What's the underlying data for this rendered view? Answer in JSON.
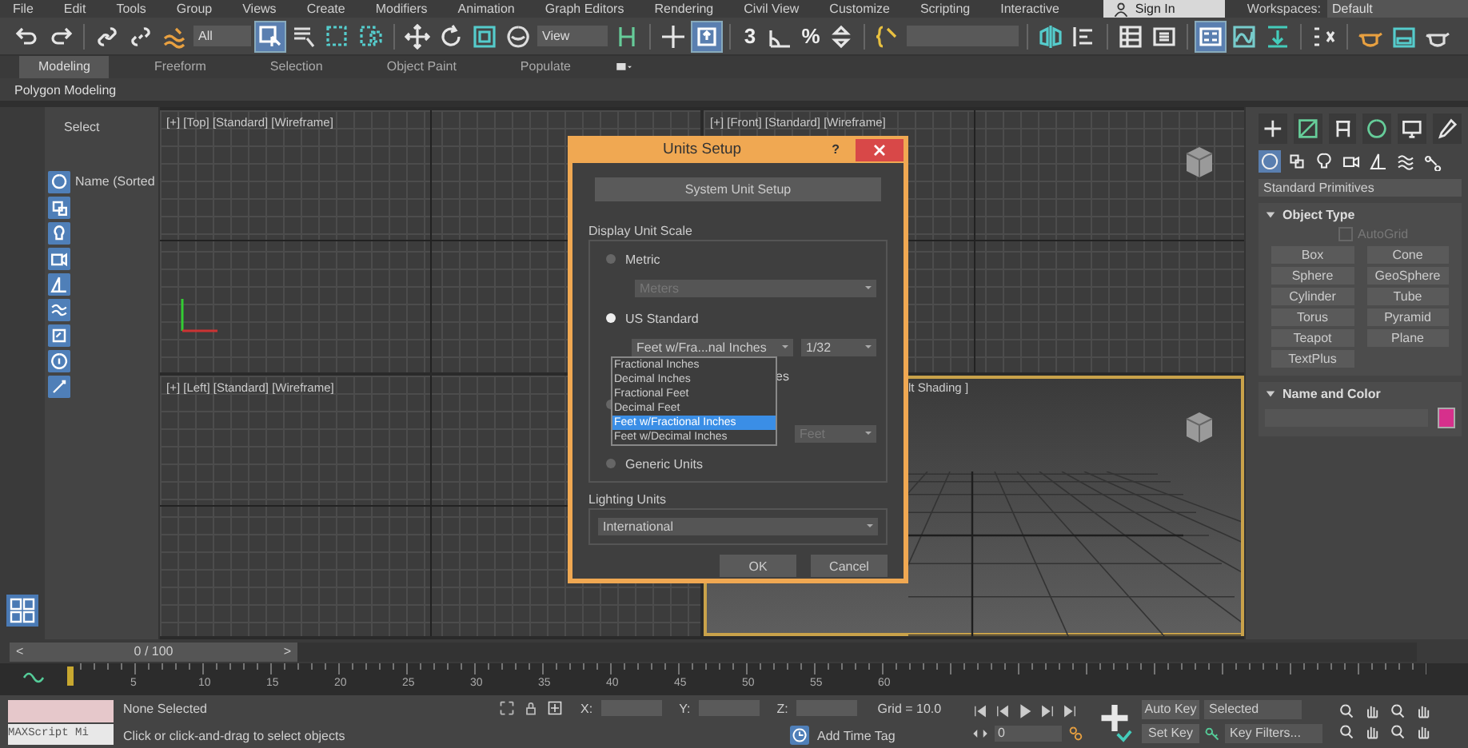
{
  "menu": [
    "File",
    "Edit",
    "Tools",
    "Group",
    "Views",
    "Create",
    "Modifiers",
    "Animation",
    "Graph Editors",
    "Rendering",
    "Civil View",
    "Customize",
    "Scripting",
    "Interactive"
  ],
  "sign_in": "Sign In",
  "workspaces": {
    "label": "Workspaces:",
    "value": "Default"
  },
  "toolbar": {
    "selection_filter": "All",
    "reference_coordinate": "View",
    "snap_labels": [
      "3",
      "%"
    ],
    "select_tool_selected": true,
    "manipulate_selected": true,
    "layout_selected": true
  },
  "ribbon": {
    "tabs": [
      {
        "label": "Modeling",
        "selected": true
      },
      {
        "label": "Freeform",
        "selected": false
      },
      {
        "label": "Selection",
        "selected": false
      },
      {
        "label": "Object Paint",
        "selected": false
      },
      {
        "label": "Populate",
        "selected": false
      }
    ],
    "panel": "Polygon Modeling"
  },
  "scene_explorer": {
    "title": "Select",
    "column": "Name (Sorted"
  },
  "viewports": [
    {
      "label": "[+] [Top] [Standard] [Wireframe]",
      "kind": "top",
      "active": false
    },
    {
      "label": "[+] [Front] [Standard] [Wireframe]",
      "kind": "front",
      "active": false
    },
    {
      "label": "[+] [Left] [Standard] [Wireframe]",
      "kind": "left",
      "active": false
    },
    {
      "label": "lt Shading ]",
      "kind": "perspective",
      "active": true
    }
  ],
  "dialog": {
    "title": "Units Setup",
    "help": "?",
    "system_button": "System Unit Setup",
    "display_group": "Display Unit Scale",
    "options": [
      {
        "kind": "radio",
        "label": "Metric",
        "selected": false
      },
      {
        "kind": "dropdown",
        "value": "Meters",
        "disabled": true
      },
      {
        "kind": "radio",
        "label": "US Standard",
        "selected": true
      },
      {
        "kind": "dropdown_pair",
        "value": "Feet w/Fra...nal Inches",
        "second": "1/32"
      },
      {
        "kind": "text",
        "label": "es"
      },
      {
        "kind": "radio",
        "selected": false
      },
      {
        "kind": "short_dropdown",
        "value": "Feet",
        "disabled": true
      },
      {
        "kind": "radio",
        "label": "Generic Units",
        "selected": false
      }
    ],
    "open_list": [
      {
        "label": "Fractional Inches",
        "selected": false
      },
      {
        "label": "Decimal Inches",
        "selected": false
      },
      {
        "label": "Fractional Feet",
        "selected": false
      },
      {
        "label": "Decimal Feet",
        "selected": false
      },
      {
        "label": "Feet w/Fractional Inches",
        "selected": true
      },
      {
        "label": "Feet w/Decimal Inches",
        "selected": false
      }
    ],
    "lighting_group": "Lighting Units",
    "lighting_value": "International",
    "buttons": [
      "OK",
      "Cancel"
    ]
  },
  "command_panel": {
    "tabs": [
      {
        "selected": false
      },
      {
        "selected": false
      },
      {
        "selected": false
      },
      {
        "selected": false
      },
      {
        "selected": false
      },
      {
        "selected": false
      }
    ],
    "categories": [
      {
        "selected": true
      },
      {
        "selected": false
      },
      {
        "selected": false
      },
      {
        "selected": false
      },
      {
        "selected": false
      },
      {
        "selected": false
      },
      {
        "selected": false
      }
    ],
    "primitive_type": "Standard Primitives",
    "object_type": "Object Type",
    "autogrid": {
      "label": "AutoGrid",
      "checked": false,
      "disabled": true
    },
    "buttons": [
      "Box",
      "Cone",
      "Sphere",
      "GeoSphere",
      "Cylinder",
      "Tube",
      "Torus",
      "Pyramid",
      "Teapot",
      "Plane",
      "TextPlus"
    ],
    "name_color": {
      "title": "Name and Color",
      "color": "#d6308c"
    }
  },
  "time_slider": {
    "level": 0,
    "label": "0 / 100",
    "prev": "<",
    "next": ">"
  },
  "ruler_labels": [
    "5",
    "10",
    "15",
    "20",
    "25",
    "30",
    "35",
    "40",
    "45",
    "50",
    "55",
    "60"
  ],
  "status": {
    "maxscript": "MAXScript Mi",
    "selection": "None Selected",
    "prompt": "Click or click-and-drag to select objects",
    "coords": [
      "X:",
      "Y:",
      "Z:"
    ],
    "grid": "Grid = 10.0",
    "time_tag": "Add Time Tag",
    "frame": "0",
    "auto_key": "Auto Key",
    "key_mode": "Selected",
    "set_key": "Set Key",
    "key_filters": "Key Filters..."
  }
}
